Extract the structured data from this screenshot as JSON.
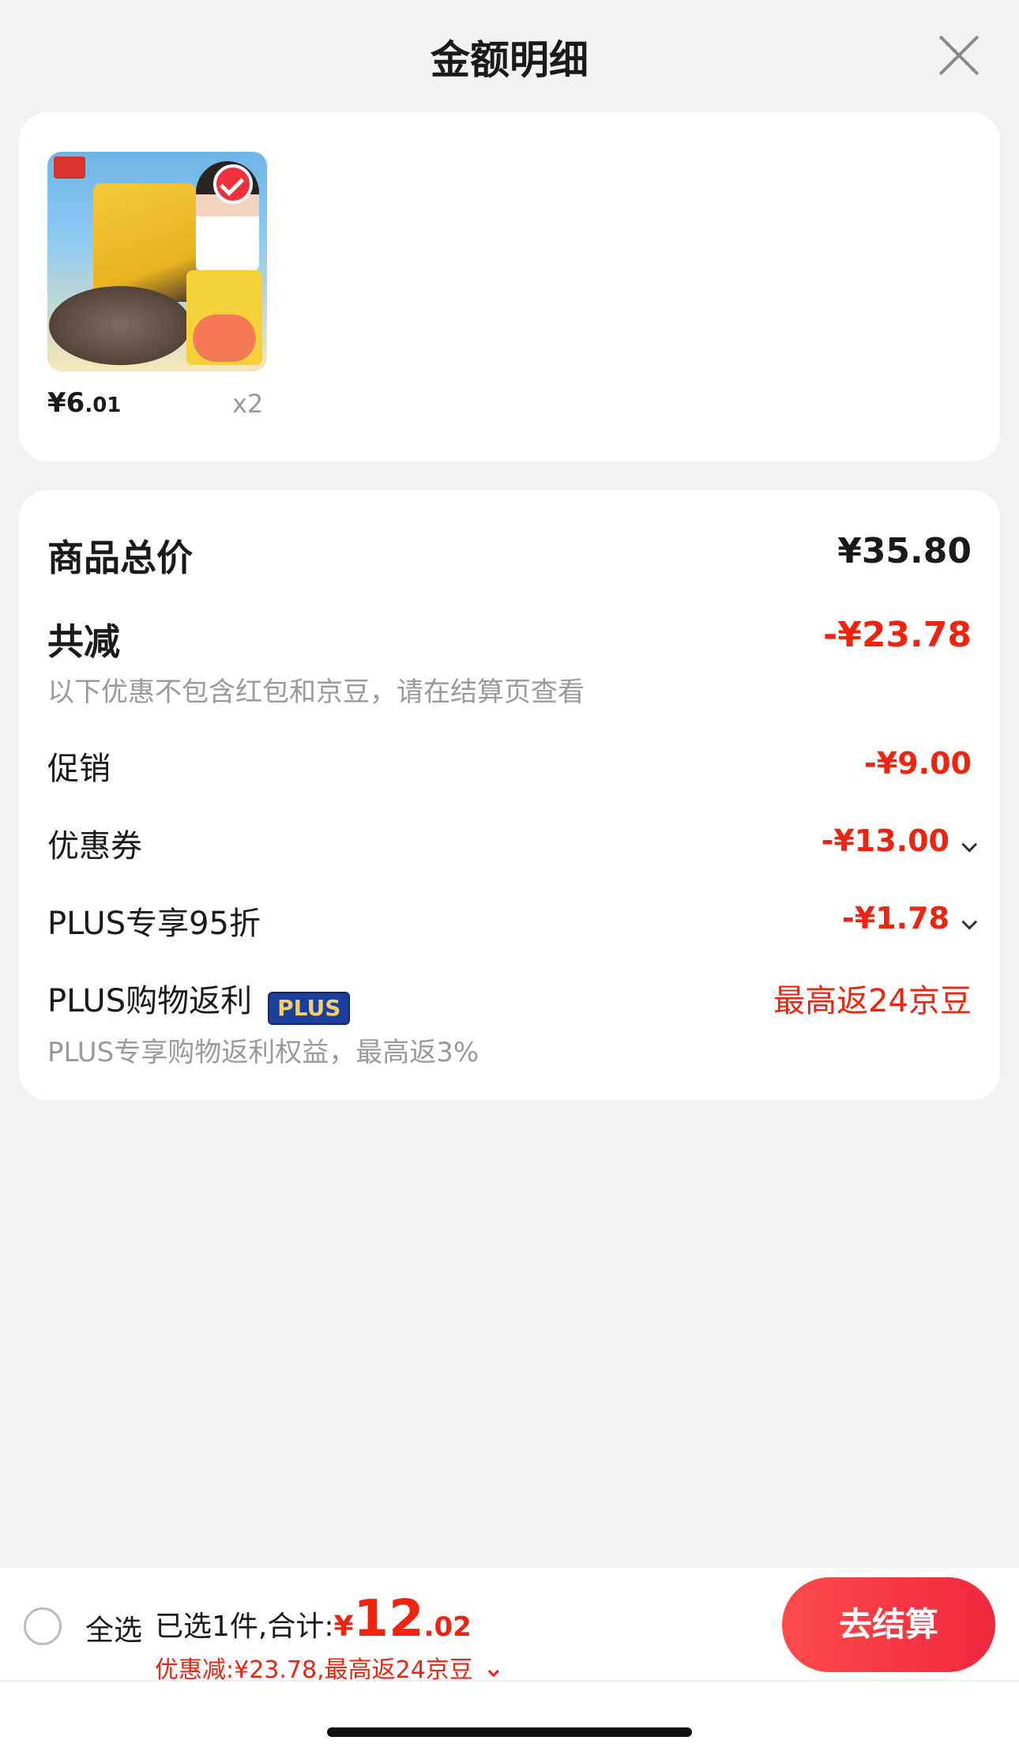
{
  "header": {
    "title": "金额明细"
  },
  "product": {
    "price_int": "¥6",
    "price_dec": ".01",
    "quantity": "x2"
  },
  "detail": {
    "total_label": "商品总价",
    "total_value": "¥35.80",
    "reduce_label": "共减",
    "reduce_value": "-¥23.78",
    "reduce_note": "以下优惠不包含红包和京豆，请在结算页查看",
    "promo_label": "促销",
    "promo_value": "-¥9.00",
    "coupon_label": "优惠券",
    "coupon_value": "-¥13.00",
    "plus_discount_label": "PLUS专享95折",
    "plus_discount_value": "-¥1.78",
    "plus_rebate_label": "PLUS购物返利",
    "plus_badge": "PLUS",
    "plus_rebate_value": "最高返24京豆",
    "plus_rebate_note": "PLUS专享购物返利权益，最高返3%"
  },
  "footer": {
    "select_all": "全选",
    "selected_summary": "已选1件,合计:",
    "total_currency": "¥",
    "total_int": "12",
    "total_dec": ".02",
    "discount_summary": "优惠减:¥23.78,最高返24京豆",
    "checkout": "去结算"
  },
  "colors": {
    "accent_red": "#f0230f",
    "plus_badge_bg": "#1c3f9c",
    "plus_badge_text": "#f2cf6b"
  }
}
